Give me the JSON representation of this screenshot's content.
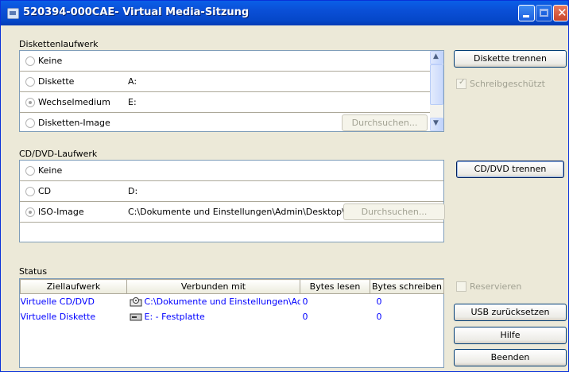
{
  "window": {
    "title": "520394-000CAE- Virtual Media-Sitzung"
  },
  "floppy": {
    "section_label": "Diskettenlaufwerk",
    "options": [
      {
        "label": "Keine",
        "value": "",
        "selected": false
      },
      {
        "label": "Diskette",
        "value": "A:",
        "selected": false
      },
      {
        "label": "Wechselmedium",
        "value": "E:",
        "selected": true
      },
      {
        "label": "Disketten-Image",
        "value": "",
        "selected": false
      }
    ],
    "browse_label": "Durchsuchen...",
    "disconnect_label": "Diskette trennen",
    "write_protect_label": "Schreibgeschützt",
    "write_protect_checked": true
  },
  "cd": {
    "section_label": "CD/DVD-Laufwerk",
    "options": [
      {
        "label": "Keine",
        "value": "",
        "selected": false
      },
      {
        "label": "CD",
        "value": "D:",
        "selected": false
      },
      {
        "label": "ISO-Image",
        "value": "C:\\Dokumente und Einstellungen\\Admin\\Desktop\\N...",
        "selected": true
      }
    ],
    "browse_label": "Durchsuchen...",
    "disconnect_label": "CD/DVD trennen"
  },
  "status": {
    "section_label": "Status",
    "columns": [
      "Ziellaufwerk",
      "Verbunden mit",
      "Bytes lesen",
      "Bytes schreiben"
    ],
    "rows": [
      {
        "target": "Virtuelle CD/DVD",
        "connected": "C:\\Dokumente und Einstellungen\\Ad...",
        "bytes_read": "0",
        "bytes_written": "0",
        "icon": "cd-drive-icon"
      },
      {
        "target": "Virtuelle Diskette",
        "connected": "E: - Festplatte",
        "bytes_read": "0",
        "bytes_written": "0",
        "icon": "hard-drive-icon"
      }
    ]
  },
  "side": {
    "reserve_label": "Reservieren",
    "reserve_checked": false,
    "usb_reset_label": "USB zurücksetzen",
    "help_label": "Hilfe",
    "exit_label": "Beenden"
  },
  "colors": {
    "titlebar": "#0a4fd6",
    "window_bg": "#ece9d8",
    "link_text": "#0000ff"
  }
}
